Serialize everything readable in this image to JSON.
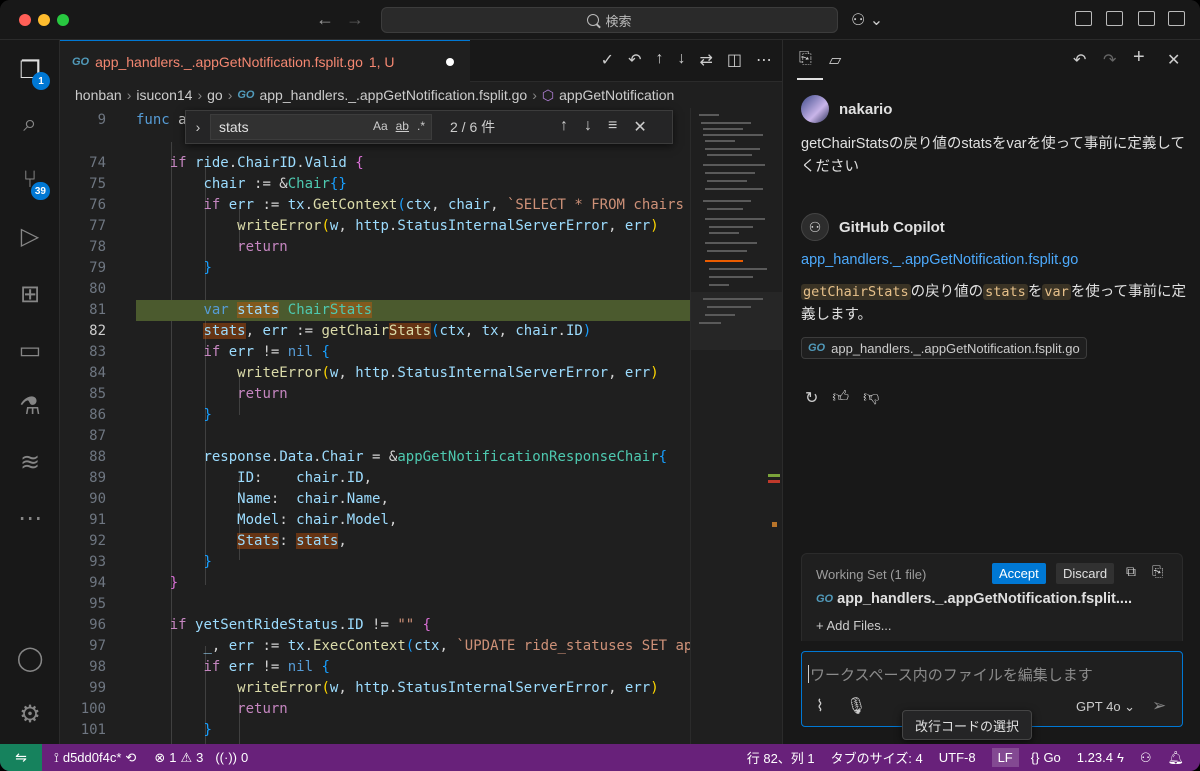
{
  "search": {
    "label": "検索"
  },
  "editor": {
    "tab": {
      "go_tag": "GO",
      "title": "app_handlers._.appGetNotification.fsplit.go",
      "status": "1, U"
    },
    "breadcrumb": [
      "honban",
      "isucon14",
      "go",
      "app_handlers._.appGetNotification.fsplit.go",
      "appGetNotification"
    ],
    "find": {
      "query": "stats",
      "opt_case": "Aa",
      "opt_word": "ab",
      "opt_regex": ".*",
      "count": "2 / 6 件"
    }
  },
  "activity": {
    "explorer_badge": "1",
    "scm_badge": "39"
  },
  "chat": {
    "user": {
      "name": "nakario",
      "message": "getChairStatsの戻り値のstatsをvarを使って事前に定義してください"
    },
    "assistant": {
      "name": "GitHub Copilot",
      "file_link": "app_handlers._.appGetNotification.fsplit.go",
      "resp_code1": "getChairStats",
      "resp_t1": "の戻り値の",
      "resp_code2": "stats",
      "resp_t2": "を",
      "resp_code3": "var",
      "resp_t3": "を使って事前に定義します。",
      "ref_chip": "app_handlers._.appGetNotification.fsplit.go"
    },
    "working_set": {
      "label": "Working Set (1 file)",
      "accept": "Accept",
      "discard": "Discard",
      "file": "app_handlers._.appGetNotification.fsplit....",
      "add_files": "Add Files..."
    },
    "input": {
      "placeholder": "ワークスペース内のファイルを編集します",
      "model": "GPT 4o"
    },
    "tooltip": "改行コードの選択"
  },
  "status": {
    "branch": "d5dd0f4c*",
    "errors": "1",
    "warnings": "3",
    "ports": "0",
    "position": "行 82、列 1",
    "tab_size": "タブのサイズ: 4",
    "encoding": "UTF-8",
    "eol": "LF",
    "language": "Go",
    "go_version": "1.23.4"
  },
  "colors": {
    "accent": "#0078d4",
    "statusbar": "#68217a",
    "remote": "#16825d",
    "match_line": "#4b5a2e",
    "link": "#4daafc"
  }
}
